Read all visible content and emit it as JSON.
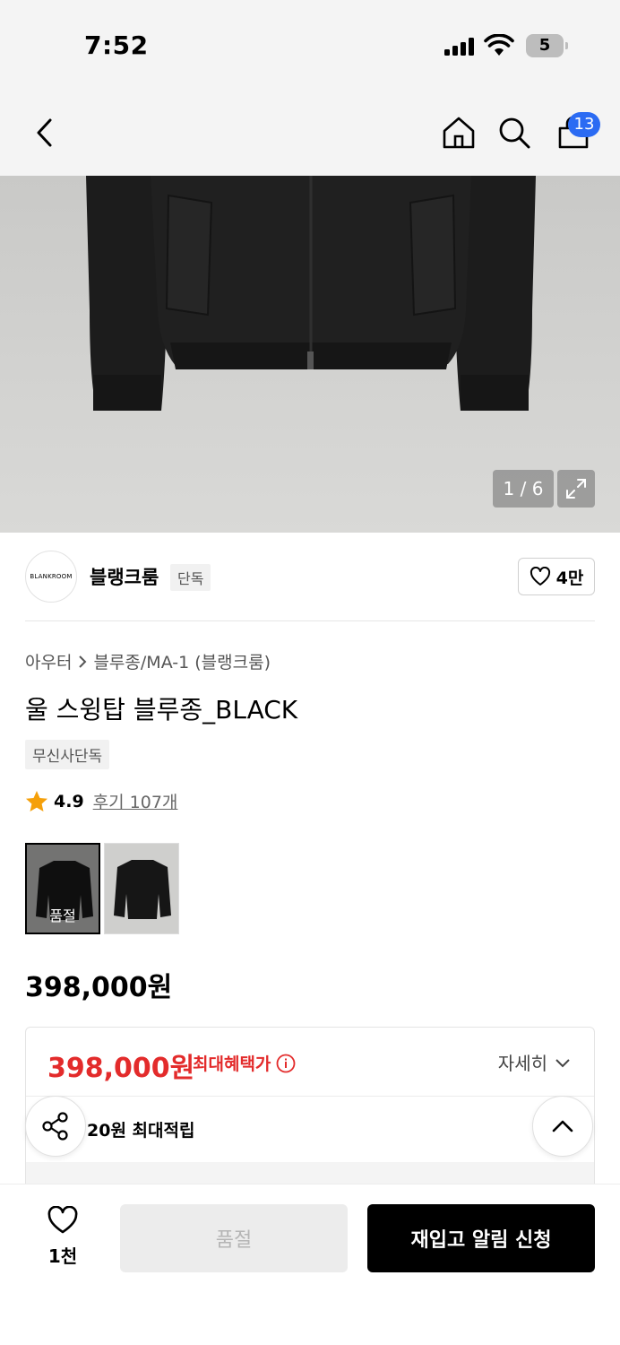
{
  "status_bar": {
    "time": "7:52",
    "battery": "5"
  },
  "nav": {
    "cart_count": "13",
    "icons": [
      "back-icon",
      "home-icon",
      "search-icon",
      "cart-icon"
    ]
  },
  "gallery": {
    "counter": "1 / 6"
  },
  "brand": {
    "logo_text": "BLANKROOM",
    "name": "블랭크룸",
    "tag": "단독",
    "likes": "4만"
  },
  "product": {
    "breadcrumb": [
      "아우터",
      "블루종/MA-1 (블랭크룸)"
    ],
    "title": "울 스윙탑 블루종_BLACK",
    "badge": "무신사단독",
    "rating": "4.9",
    "reviews": "후기 107개",
    "swatch_sold_label": "품절",
    "price": "398,000원"
  },
  "benefit": {
    "price": "398,000원",
    "label": "최대혜택가",
    "detail": "자세히",
    "points": "20원 최대적립"
  },
  "bottom": {
    "wish_count": "1천",
    "soldout": "품절",
    "restock": "재입고 알림 신청"
  },
  "colors": {
    "accent_red": "#e32b2b",
    "badge_blue": "#2b6bf3",
    "star": "#f5a00a"
  }
}
